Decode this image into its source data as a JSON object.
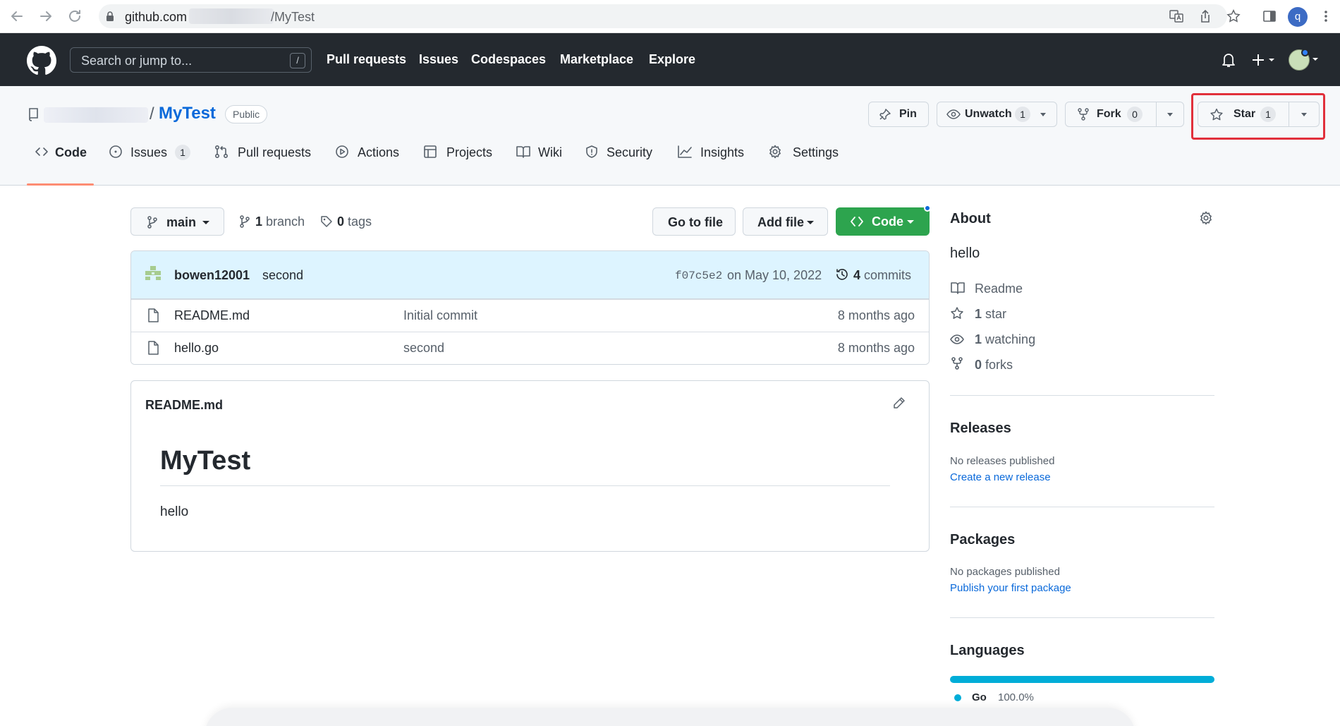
{
  "browser": {
    "host": "github.com",
    "path": "/MyTest",
    "profile_initial": "q"
  },
  "header": {
    "search_placeholder": "Search or jump to...",
    "search_shortcut": "/",
    "nav": [
      "Pull requests",
      "Issues",
      "Codespaces",
      "Marketplace",
      "Explore"
    ]
  },
  "repo": {
    "name": "MyTest",
    "visibility": "Public",
    "pin_label": "Pin",
    "unwatch_label": "Unwatch",
    "watch_count": "1",
    "fork_label": "Fork",
    "fork_count": "0",
    "star_label": "Star",
    "star_count": "1"
  },
  "tabs": [
    {
      "label": "Code",
      "icon": "code-icon"
    },
    {
      "label": "Issues",
      "icon": "issue-icon",
      "count": "1"
    },
    {
      "label": "Pull requests",
      "icon": "pull-request-icon"
    },
    {
      "label": "Actions",
      "icon": "play-icon"
    },
    {
      "label": "Projects",
      "icon": "table-icon"
    },
    {
      "label": "Wiki",
      "icon": "book-icon"
    },
    {
      "label": "Security",
      "icon": "shield-icon"
    },
    {
      "label": "Insights",
      "icon": "graph-icon"
    },
    {
      "label": "Settings",
      "icon": "gear-icon"
    }
  ],
  "branchbar": {
    "branch": "main",
    "branch_count": "1",
    "branch_word": "branch",
    "tag_count": "0",
    "tag_word": "tags",
    "go_to_file": "Go to file",
    "add_file": "Add file",
    "code": "Code"
  },
  "latest_commit": {
    "author": "bowen12001",
    "message": "second",
    "sha": "f07c5e2",
    "date": "on May 10, 2022",
    "commit_count": "4",
    "commit_word": "commits"
  },
  "files": [
    {
      "name": "README.md",
      "message": "Initial commit",
      "age": "8 months ago"
    },
    {
      "name": "hello.go",
      "message": "second",
      "age": "8 months ago"
    }
  ],
  "readme": {
    "filename": "README.md",
    "heading": "MyTest",
    "body": "hello"
  },
  "about": {
    "title": "About",
    "description": "hello",
    "readme": "Readme",
    "stars_count": "1",
    "stars_word": "star",
    "watching_count": "1",
    "watching_word": "watching",
    "forks_count": "0",
    "forks_word": "forks"
  },
  "releases": {
    "title": "Releases",
    "none_text": "No releases published",
    "link": "Create a new release"
  },
  "packages": {
    "title": "Packages",
    "none_text": "No packages published",
    "link": "Publish your first package"
  },
  "languages": {
    "title": "Languages",
    "items": [
      {
        "name": "Go",
        "percent": "100.0%",
        "share": 1.0,
        "color": "#00add8"
      }
    ]
  }
}
